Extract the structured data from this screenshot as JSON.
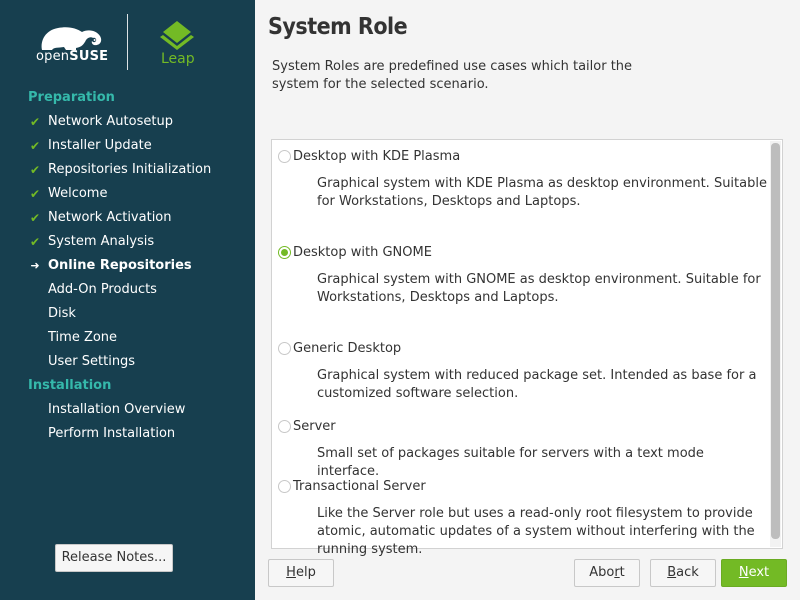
{
  "branding": {
    "distro_prefix": "open",
    "distro_name": "SUSE",
    "edition": "Leap",
    "logo_icon": "gecko-icon",
    "edition_icon": "leap-chevron-icon"
  },
  "sidebar": {
    "sections": [
      {
        "title": "Preparation",
        "steps": [
          {
            "label": "Network Autosetup",
            "status": "done"
          },
          {
            "label": "Installer Update",
            "status": "done"
          },
          {
            "label": "Repositories Initialization",
            "status": "done"
          },
          {
            "label": "Welcome",
            "status": "done"
          },
          {
            "label": "Network Activation",
            "status": "done"
          },
          {
            "label": "System Analysis",
            "status": "done"
          },
          {
            "label": "Online Repositories",
            "status": "current"
          },
          {
            "label": "Add-On Products",
            "status": "pending"
          },
          {
            "label": "Disk",
            "status": "pending"
          },
          {
            "label": "Time Zone",
            "status": "pending"
          },
          {
            "label": "User Settings",
            "status": "pending"
          }
        ]
      },
      {
        "title": "Installation",
        "steps": [
          {
            "label": "Installation Overview",
            "status": "pending"
          },
          {
            "label": "Perform Installation",
            "status": "pending"
          }
        ]
      }
    ],
    "marks": {
      "done": "✔",
      "current": "➜",
      "pending": ""
    },
    "release_notes_button": "Release Notes..."
  },
  "main": {
    "title": "System Role",
    "description": "System Roles are predefined use cases which tailor the system for the selected scenario.",
    "roles": [
      {
        "label": "Desktop with KDE Plasma",
        "selected": false,
        "description": "Graphical system with KDE Plasma as desktop environment. Suitable for Workstations, Desktops and Laptops."
      },
      {
        "label": "Desktop with GNOME",
        "selected": true,
        "description": "Graphical system with GNOME as desktop environment. Suitable for Workstations, Desktops and Laptops."
      },
      {
        "label": "Generic Desktop",
        "selected": false,
        "description": "Graphical system with reduced package set. Intended as base for a customized software selection."
      },
      {
        "label": "Server",
        "selected": false,
        "description": "Small set of packages suitable for servers with a text mode interface."
      },
      {
        "label": "Transactional Server",
        "selected": false,
        "description": "Like the Server role but uses a read-only root filesystem to provide atomic, automatic updates of a system without interfering with the running system."
      }
    ]
  },
  "footer": {
    "help": {
      "pre": "",
      "key": "H",
      "post": "elp"
    },
    "abort": {
      "pre": "Abo",
      "key": "r",
      "post": "t"
    },
    "back": {
      "pre": "",
      "key": "B",
      "post": "ack"
    },
    "next": {
      "pre": "",
      "key": "N",
      "post": "ext"
    }
  },
  "colors": {
    "sidebar_bg": "#173f4f",
    "section_title": "#35b9ab",
    "accent_green": "#73ba25"
  }
}
